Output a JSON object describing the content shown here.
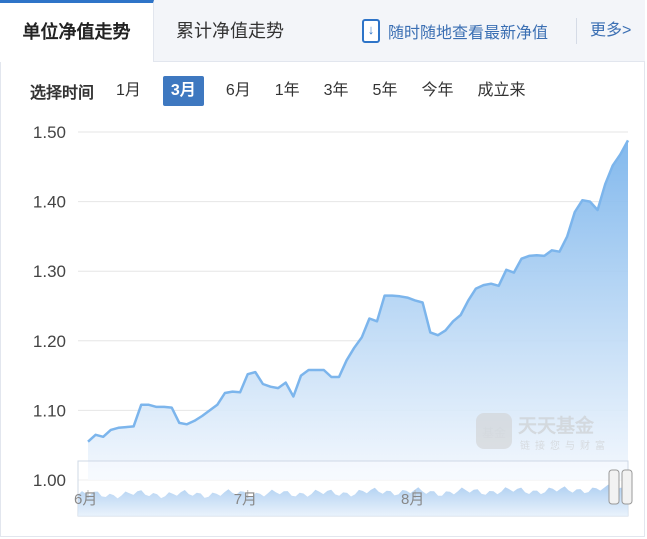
{
  "tabs": {
    "nav_unit": "单位净值走势",
    "nav_cumulative": "累计净值走势",
    "mobile_promo": "随时随地查看最新净值",
    "more": "更多>"
  },
  "range": {
    "label": "选择时间",
    "options": [
      "1月",
      "3月",
      "6月",
      "1年",
      "3年",
      "5年",
      "今年",
      "成立来"
    ],
    "selected": "3月"
  },
  "watermark": {
    "brand": "天天基金",
    "slogan": "链接您与财富",
    "badge": "基金"
  },
  "colors": {
    "accent": "#3e78c0",
    "line": "#7cb5ec",
    "area_top": "#7cb5ec",
    "area_bottom": "#f2f7fd"
  },
  "chart_data": {
    "type": "area",
    "title": "单位净值走势",
    "ylim": [
      1.0,
      1.5
    ],
    "yticks": [
      {
        "value": 1.0,
        "label": "1.00"
      },
      {
        "value": 1.1,
        "label": "1.10"
      },
      {
        "value": 1.2,
        "label": "1.20"
      },
      {
        "value": 1.3,
        "label": "1.30"
      },
      {
        "value": 1.4,
        "label": "1.40"
      },
      {
        "value": 1.5,
        "label": "1.50"
      }
    ],
    "xticks": [
      {
        "index": 0,
        "label": "6月"
      },
      {
        "index": 21,
        "label": "7月"
      },
      {
        "index": 43,
        "label": "8月"
      }
    ],
    "series": [
      {
        "values": [
          1.055,
          1.065,
          1.062,
          1.072,
          1.075,
          1.076,
          1.077,
          1.108,
          1.108,
          1.105,
          1.105,
          1.104,
          1.082,
          1.08,
          1.085,
          1.092,
          1.1,
          1.108,
          1.125,
          1.127,
          1.126,
          1.152,
          1.155,
          1.138,
          1.134,
          1.132,
          1.14,
          1.12,
          1.15,
          1.158,
          1.158,
          1.158,
          1.148,
          1.148,
          1.172,
          1.19,
          1.205,
          1.232,
          1.228,
          1.265,
          1.265,
          1.264,
          1.262,
          1.258,
          1.255,
          1.212,
          1.208,
          1.215,
          1.228,
          1.237,
          1.258,
          1.275,
          1.28,
          1.282,
          1.279,
          1.302,
          1.298,
          1.318,
          1.322,
          1.323,
          1.322,
          1.33,
          1.328,
          1.35,
          1.385,
          1.402,
          1.4,
          1.388,
          1.425,
          1.452,
          1.468,
          1.488
        ]
      }
    ]
  }
}
